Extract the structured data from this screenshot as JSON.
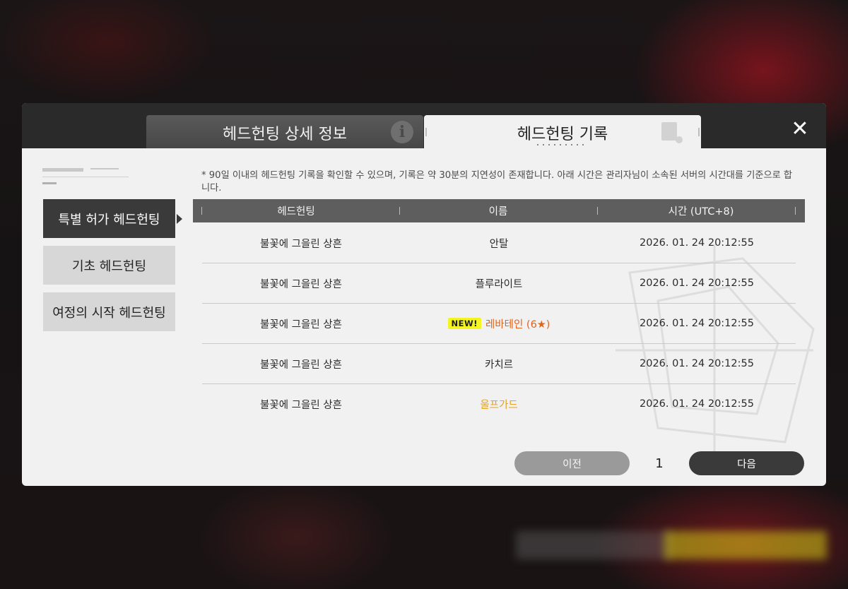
{
  "tabs": {
    "details": "헤드헌팅 상세 정보",
    "history": "헤드헌팅 기록",
    "info_icon": "i"
  },
  "close": "✕",
  "sidebar": {
    "items": [
      {
        "label": "특별 허가 헤드헌팅",
        "active": true
      },
      {
        "label": "기초 헤드헌팅",
        "active": false
      },
      {
        "label": "여정의 시작 헤드헌팅",
        "active": false
      }
    ]
  },
  "notice": "* 90일 이내의 헤드헌팅 기록을 확인할 수 있으며, 기록은 약 30분의 지연성이 존재합니다. 아래 시간은 관리자님이 소속된 서버의 시간대를 기준으로 합니다.",
  "table": {
    "headers": [
      "헤드헌팅",
      "이름",
      "시간 (UTC+8)"
    ],
    "rows": [
      {
        "banner": "불꽃에 그을린 상흔",
        "name": "안탈",
        "time": "2026. 01. 24 20:12:55"
      },
      {
        "banner": "불꽃에 그을린 상흔",
        "name": "플루라이트",
        "time": "2026. 01. 24 20:12:55"
      },
      {
        "banner": "불꽃에 그을린 상흔",
        "name": "레바테인 (6★)",
        "badge": "NEW!",
        "time": "2026. 01. 24 20:12:55"
      },
      {
        "banner": "불꽃에 그을린 상흔",
        "name": "카치르",
        "time": "2026. 01. 24 20:12:55"
      },
      {
        "banner": "불꽃에 그을린 상흔",
        "name": "울프가드",
        "time": "2026. 01. 24 20:12:55"
      }
    ]
  },
  "pagination": {
    "prev": "이전",
    "page": "1",
    "next": "다음"
  },
  "colors": {
    "six_star": "#e0641a",
    "five_star": "#e4a321",
    "new_badge": "#f4f422"
  }
}
